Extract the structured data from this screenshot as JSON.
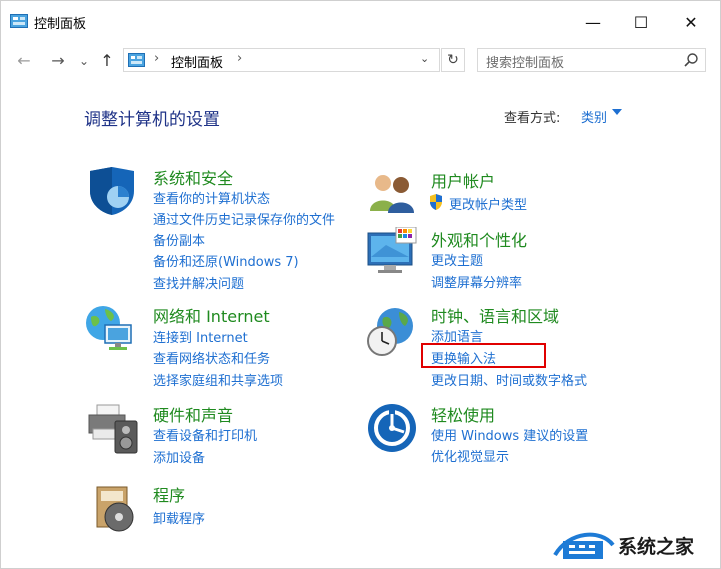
{
  "window": {
    "title": "控制面板",
    "minimize": "—",
    "maximize": "☐",
    "close": "✕"
  },
  "nav": {
    "back": "←",
    "forward": "→",
    "recent": "⌄",
    "up": "↑",
    "address_sep": "›",
    "address_crumb": "控制面板",
    "address_sep2": "›",
    "address_dropdown": "⌄",
    "refresh": "↻",
    "search_placeholder": "搜索控制面板"
  },
  "header": {
    "title": "调整计算机的设置",
    "view_by_label": "查看方式:",
    "view_by_value": "类别"
  },
  "categories": {
    "system_security": {
      "title": "系统和安全",
      "links": [
        "查看你的计算机状态",
        "通过文件历史记录保存你的文件",
        "备份副本",
        "备份和还原(Windows 7)",
        "查找并解决问题"
      ]
    },
    "network": {
      "title": "网络和 Internet",
      "links": [
        "连接到 Internet",
        "查看网络状态和任务",
        "选择家庭组和共享选项"
      ]
    },
    "hardware": {
      "title": "硬件和声音",
      "links": [
        "查看设备和打印机",
        "添加设备"
      ]
    },
    "programs": {
      "title": "程序",
      "links": [
        "卸载程序"
      ]
    },
    "user_accounts": {
      "title": "用户帐户",
      "links": [
        "更改帐户类型"
      ]
    },
    "appearance": {
      "title": "外观和个性化",
      "links": [
        "更改主题",
        "调整屏幕分辨率"
      ]
    },
    "clock_region": {
      "title": "时钟、语言和区域",
      "links": [
        "添加语言",
        "更换输入法",
        "更改日期、时间或数字格式"
      ]
    },
    "ease_access": {
      "title": "轻松使用",
      "links": [
        "使用 Windows 建议的设置",
        "优化视觉显示"
      ]
    }
  },
  "watermark": {
    "text": "系统之家"
  },
  "colors": {
    "heading": "#1e3287",
    "category_title": "#1f8a1f",
    "link": "#1e6fd1",
    "highlight_box": "#e00000"
  }
}
